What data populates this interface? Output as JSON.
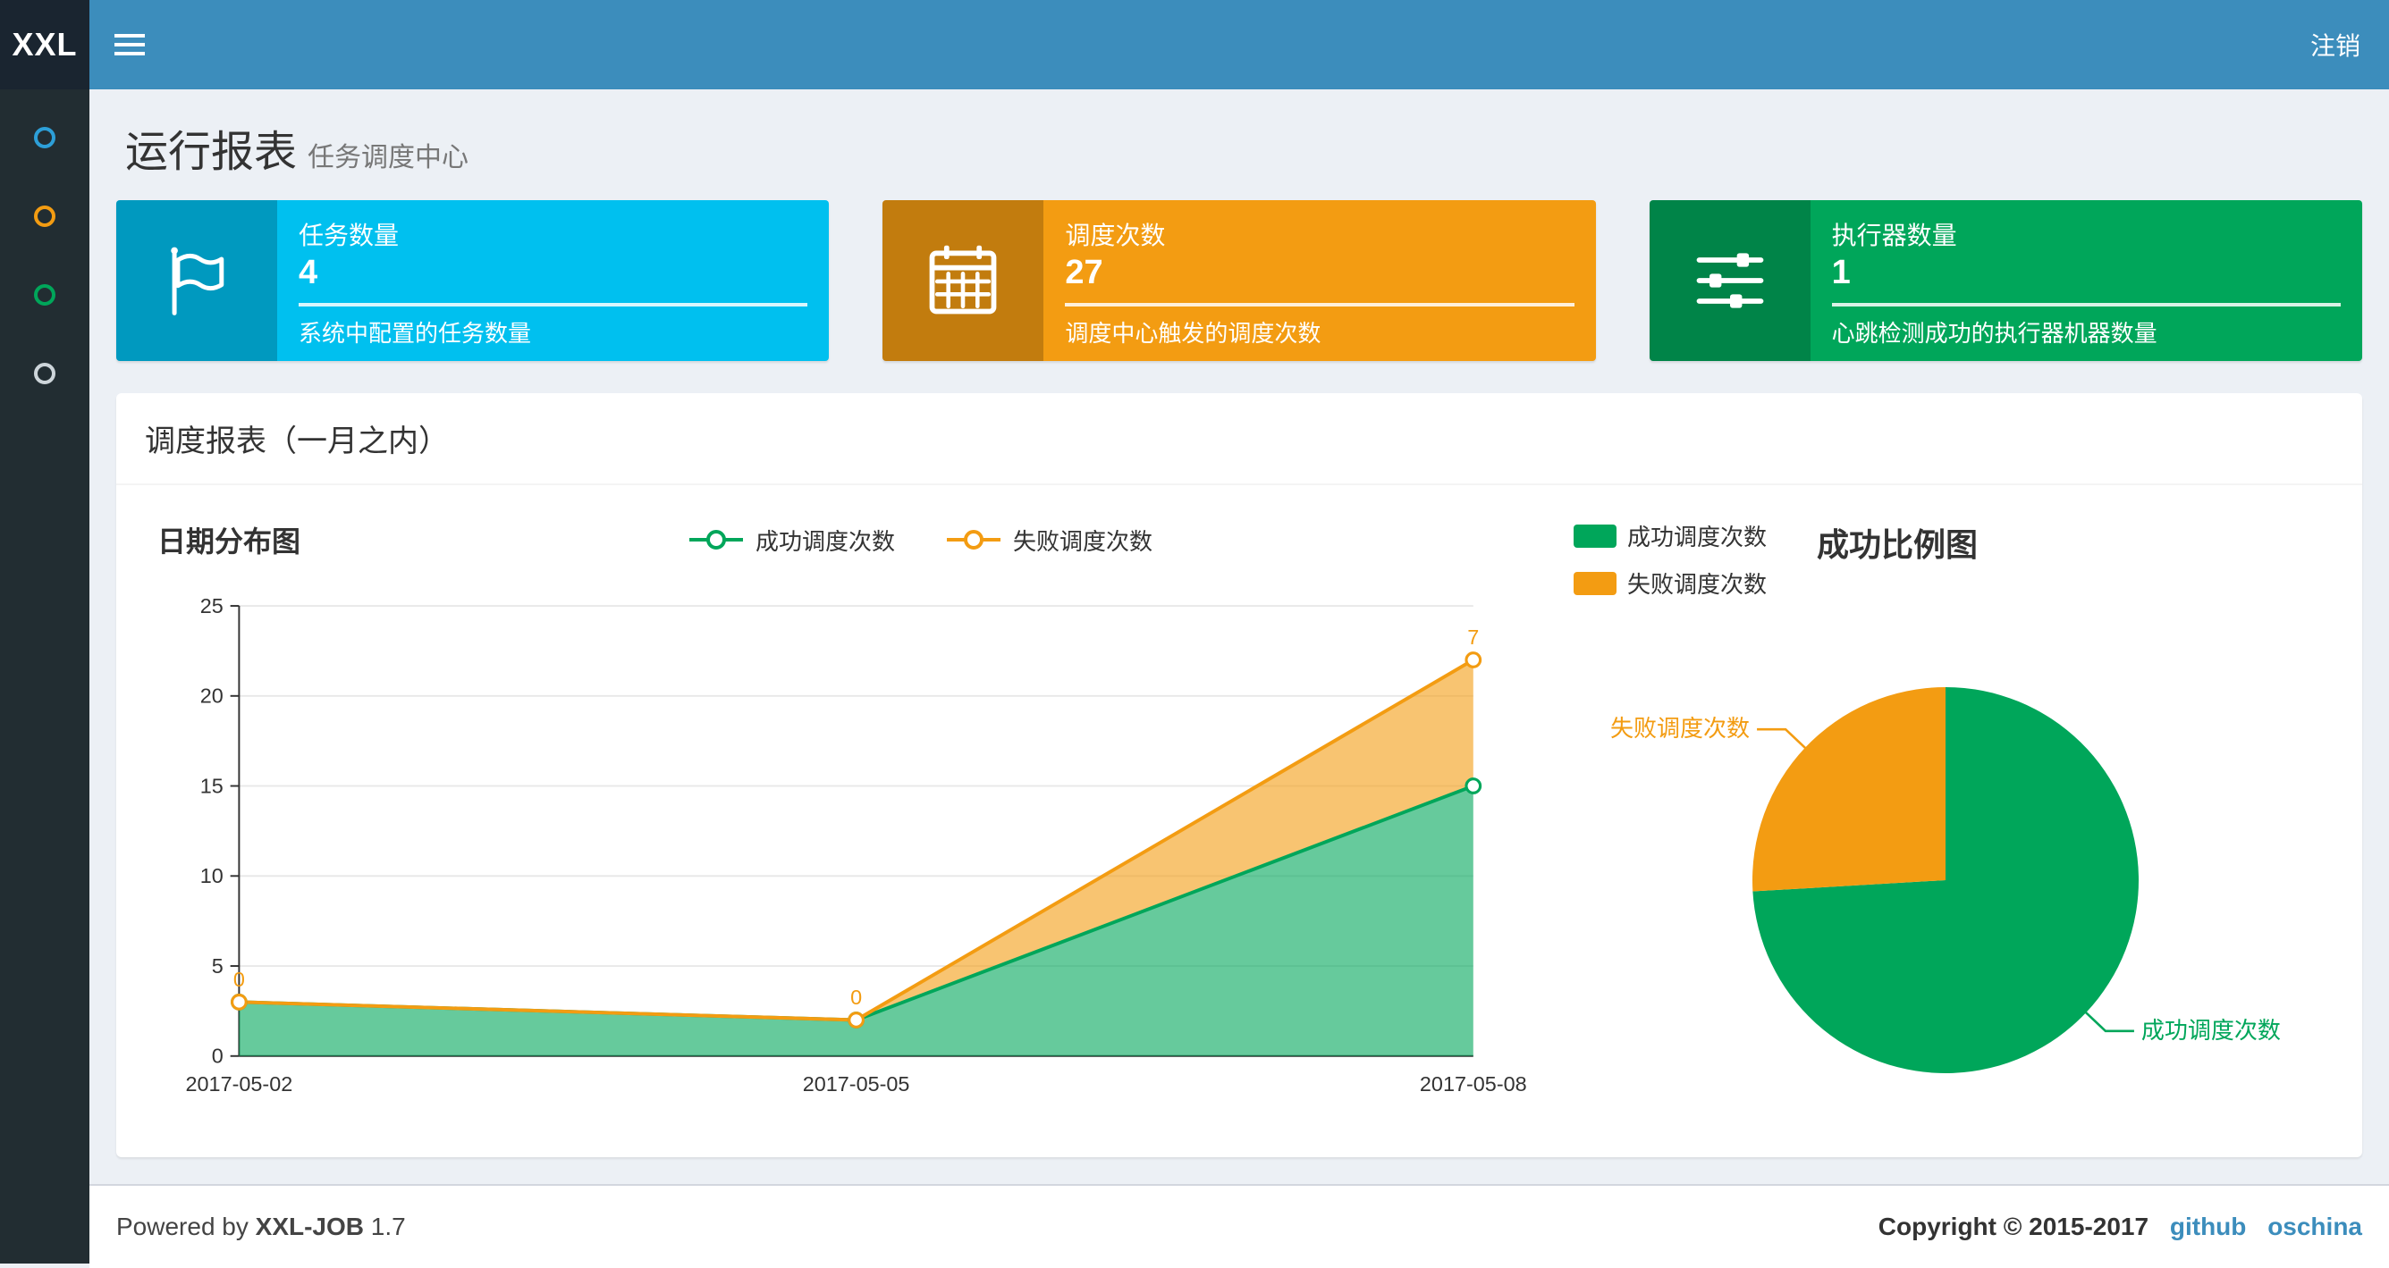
{
  "navbar": {
    "logo_text": "XXL",
    "logout_label": "注销"
  },
  "sidebar": {
    "items": [
      {
        "id": "menu-1",
        "color": "#2d9fd8"
      },
      {
        "id": "menu-2",
        "color": "#f39c12"
      },
      {
        "id": "menu-3",
        "color": "#00a65a"
      },
      {
        "id": "menu-4",
        "color": "#cdd5da"
      }
    ]
  },
  "header": {
    "title": "运行报表",
    "subtitle": "任务调度中心"
  },
  "info_boxes": [
    {
      "icon": "flag-icon",
      "label": "任务数量",
      "value": "4",
      "desc": "系统中配置的任务数量",
      "color": "#00c0ef"
    },
    {
      "icon": "calendar-icon",
      "label": "调度次数",
      "value": "27",
      "desc": "调度中心触发的调度次数",
      "color": "#f39c12"
    },
    {
      "icon": "sliders-icon",
      "label": "执行器数量",
      "value": "1",
      "desc": "心跳检测成功的执行器机器数量",
      "color": "#00a65a"
    }
  ],
  "panel": {
    "title": "调度报表（一月之内）"
  },
  "chart_data": [
    {
      "type": "area",
      "title": "日期分布图",
      "stacked": true,
      "x": [
        "2017-05-02",
        "2017-05-05",
        "2017-05-08"
      ],
      "series": [
        {
          "name": "成功调度次数",
          "color": "#00a65a",
          "values": [
            3,
            2,
            15
          ]
        },
        {
          "name": "失败调度次数",
          "color": "#f39c12",
          "values": [
            0,
            0,
            7
          ],
          "point_labels": [
            "0",
            "0",
            "7"
          ]
        }
      ],
      "ylim": [
        0,
        25
      ],
      "yticks": [
        0,
        5,
        10,
        15,
        20,
        25
      ],
      "grid": true,
      "legend_position": "top-center"
    },
    {
      "type": "pie",
      "title": "成功比例图",
      "slices": [
        {
          "name": "成功调度次数",
          "value": 20,
          "color": "#00a65a"
        },
        {
          "name": "失败调度次数",
          "value": 7,
          "color": "#f39c12"
        }
      ],
      "legend_position": "top-left"
    }
  ],
  "footer": {
    "powered_by": "Powered by",
    "product": "XXL-JOB",
    "version": "1.7",
    "copyright": "Copyright © 2015-2017",
    "links": [
      "github",
      "oschina"
    ]
  }
}
